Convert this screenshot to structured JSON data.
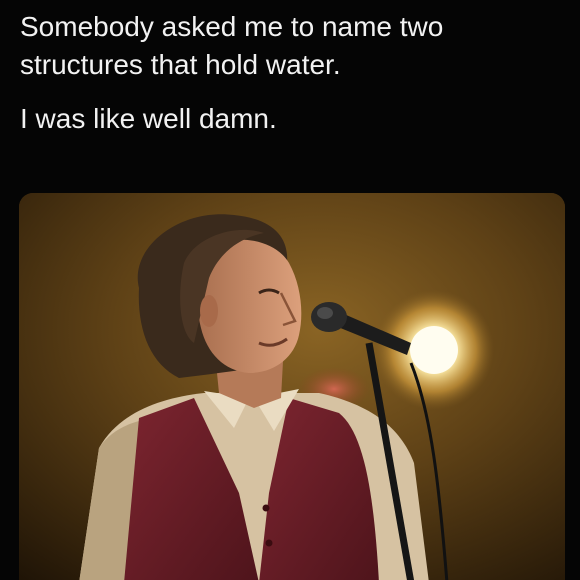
{
  "post": {
    "caption_line1": "Somebody asked me to name two structures that hold water.",
    "caption_line2": "I was like well damn."
  },
  "media": {
    "description": "photo",
    "colors": {
      "background_warm": "#6b4a1a",
      "background_dark": "#241708",
      "spotlight": "#fff6c8",
      "vest": "#6e1f26",
      "shirt": "#d9c6a8",
      "skin": "#c9906c",
      "hair": "#3a2a1c",
      "mic": "#1a1a1a"
    }
  }
}
